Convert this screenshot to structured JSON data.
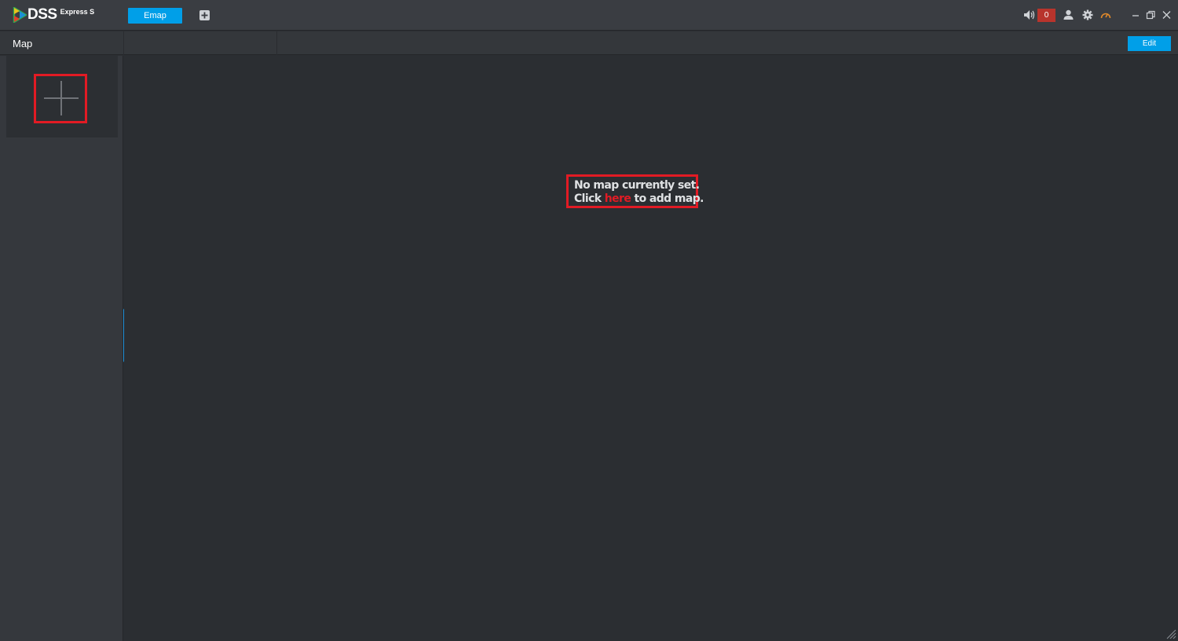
{
  "app": {
    "logo_text": "DSS",
    "logo_subtext": "Express S",
    "active_tab": "Emap"
  },
  "tray": {
    "alarm_count": "0"
  },
  "subheader": {
    "title": "Map",
    "edit_label": "Edit"
  },
  "main": {
    "empty_line1": "No map currently set.",
    "empty_click": "Click ",
    "empty_link": "here",
    "empty_tail": " to add map."
  },
  "colors": {
    "accent": "#009fe8",
    "highlight": "#e21b24",
    "alarm": "#b8342c",
    "performance": "#e0892a"
  },
  "icons": [
    "logo-icon",
    "add-tab-icon",
    "speaker-icon",
    "user-icon",
    "gear-icon",
    "performance-icon",
    "minimize-icon",
    "maximize-icon",
    "close-icon",
    "plus-icon",
    "collapse-icon",
    "resize-grip-icon"
  ]
}
